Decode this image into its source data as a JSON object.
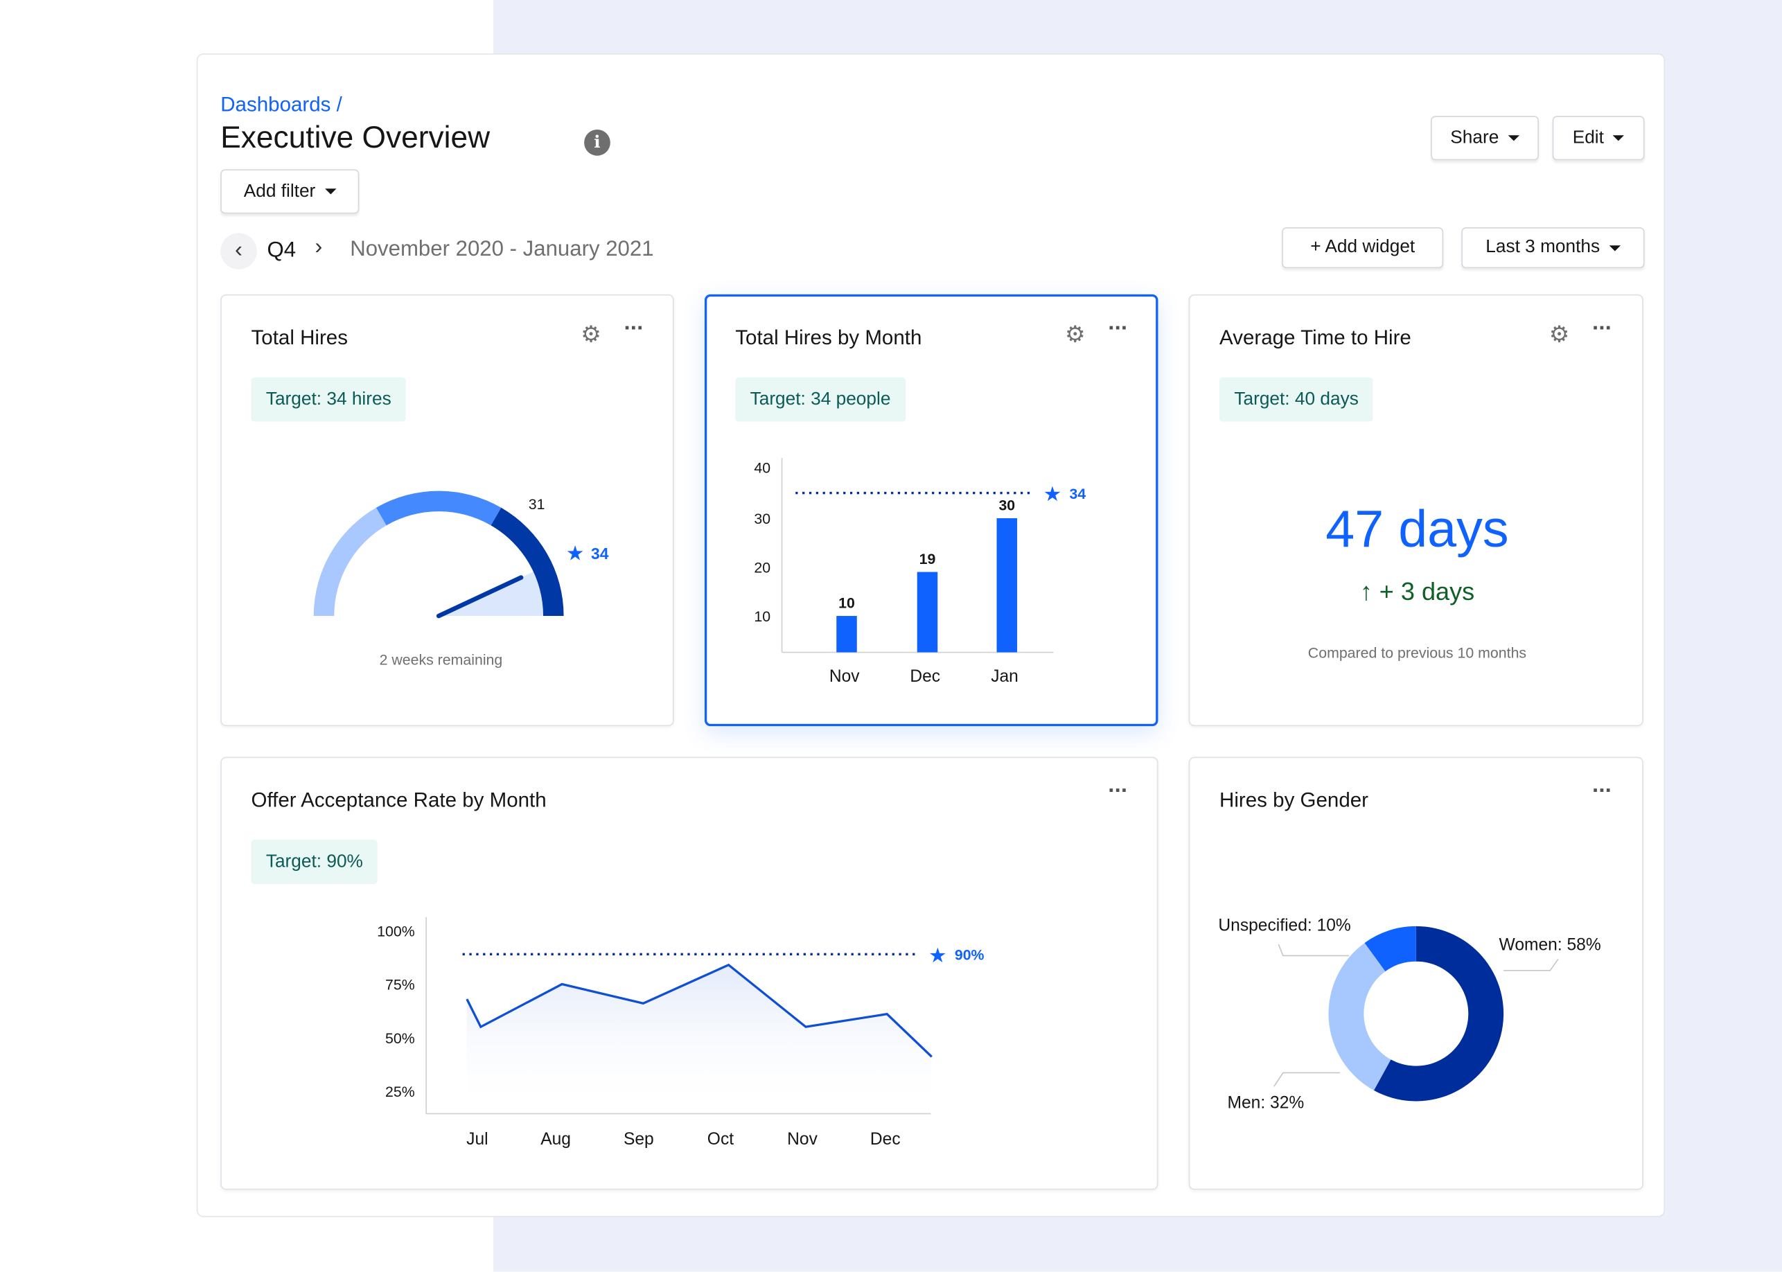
{
  "header": {
    "breadcrumb": "Dashboards /",
    "title": "Executive Overview",
    "info_icon": "info-icon",
    "add_filter": "Add filter",
    "share": "Share",
    "edit": "Edit"
  },
  "period": {
    "quarter": "Q4",
    "range": "November 2020 - January 2021",
    "add_widget": "+ Add widget",
    "range_select": "Last 3 months"
  },
  "colors": {
    "accent": "#0f62fe",
    "dark_blue": "#002d9c",
    "light_blue": "#a6c8ff",
    "green": "#0e6027"
  },
  "cards": {
    "total_hires": {
      "title": "Total Hires",
      "target": "Target: 34 hires",
      "value_label": "31",
      "target_label": "34",
      "footer": "2 weeks remaining"
    },
    "hires_by_month": {
      "title": "Total Hires by Month",
      "target": "Target: 34 people"
    },
    "time_to_hire": {
      "title": "Average Time to Hire",
      "target": "Target: 40 days",
      "value": "47 days",
      "delta": "+ 3 days",
      "footer": "Compared to previous 10 months"
    },
    "offer_acceptance": {
      "title": "Offer Acceptance Rate by Month",
      "target": "Target: 90%"
    },
    "gender": {
      "title": "Hires by Gender"
    }
  },
  "chart_data": [
    {
      "type": "gauge",
      "value": 31,
      "target": 34,
      "target_label": "34",
      "max": 36,
      "bands": [
        12,
        24,
        36
      ]
    },
    {
      "type": "bar",
      "categories": [
        "Nov",
        "Dec",
        "Jan"
      ],
      "values": [
        10,
        19,
        30
      ],
      "yticks": [
        10,
        20,
        30,
        40
      ],
      "ylim": [
        0,
        40
      ],
      "target": 34,
      "target_label": "34"
    },
    {
      "type": "line",
      "categories": [
        "Jul",
        "Aug",
        "Sep",
        "Oct",
        "Nov",
        "Dec"
      ],
      "yticks": [
        "25%",
        "50%",
        "75%",
        "100%"
      ],
      "ylim": [
        0,
        100
      ],
      "points": [
        {
          "x": -0.17,
          "y": 68
        },
        {
          "x": 0,
          "y": 55
        },
        {
          "x": 1,
          "y": 75
        },
        {
          "x": 2,
          "y": 66
        },
        {
          "x": 3.05,
          "y": 84
        },
        {
          "x": 4,
          "y": 55
        },
        {
          "x": 5,
          "y": 61
        },
        {
          "x": 5.55,
          "y": 41
        }
      ],
      "target": 89,
      "target_label": "90%"
    },
    {
      "type": "pie",
      "slices": [
        {
          "label": "Women: 58%",
          "value": 58,
          "color": "#002d9c"
        },
        {
          "label": "Men: 32%",
          "value": 32,
          "color": "#a6c8ff"
        },
        {
          "label": "Unspecified: 10%",
          "value": 10,
          "color": "#0f62fe"
        }
      ]
    }
  ]
}
